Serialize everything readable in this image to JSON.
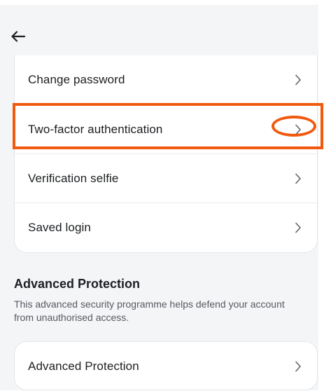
{
  "header": {
    "back_icon": "arrow-left-icon"
  },
  "security_items": [
    {
      "label": "Change password",
      "icon": "chevron-right-icon"
    },
    {
      "label": "Two-factor authentication",
      "icon": "chevron-right-icon"
    },
    {
      "label": "Verification selfie",
      "icon": "chevron-right-icon"
    },
    {
      "label": "Saved login",
      "icon": "chevron-right-icon"
    }
  ],
  "advanced_protection": {
    "title": "Advanced Protection",
    "description": "This advanced security programme helps defend your account from unauthorised access.",
    "item_label": "Advanced Protection",
    "item_icon": "chevron-right-icon"
  },
  "highlight": {
    "color": "#f05a0e",
    "target": "Two-factor authentication"
  }
}
